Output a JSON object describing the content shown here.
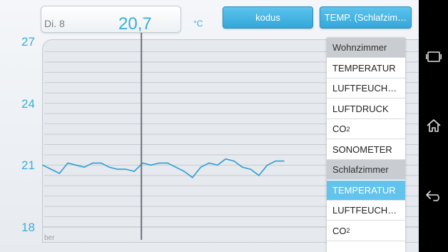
{
  "tooltip": {
    "date": "Di. 8",
    "value": "20,7",
    "unit": "°C"
  },
  "buttons": {
    "kodus": "kodus",
    "temp": "TEMP. (Schlafzim…"
  },
  "dropdown": {
    "items": [
      {
        "label": "Wohnzimmer",
        "type": "header"
      },
      {
        "label": "TEMPERATUR",
        "type": "option"
      },
      {
        "label": "LUFTFEUCH…",
        "type": "option"
      },
      {
        "label": "LUFTDRUCK",
        "type": "option"
      },
      {
        "label": "CO2",
        "type": "option"
      },
      {
        "label": "SONOMETER",
        "type": "option"
      },
      {
        "label": "Schlafzimmer",
        "type": "header"
      },
      {
        "label": "TEMPERATUR",
        "type": "selected"
      },
      {
        "label": "LUFTFEUCH…",
        "type": "option"
      },
      {
        "label": "CO2",
        "type": "option"
      }
    ]
  },
  "chart_data": {
    "type": "line",
    "title": "",
    "xlabel": "",
    "ylabel": "",
    "y_ticks": [
      "27",
      "24",
      "21",
      "18"
    ],
    "x_tick_partial": "ber",
    "ylim": [
      18,
      27
    ],
    "grid": true,
    "series": [
      {
        "color": "#2f9ed0",
        "values": [
          21.0,
          20.8,
          20.6,
          21.1,
          21.0,
          20.9,
          21.1,
          21.1,
          20.9,
          20.8,
          20.8,
          20.7,
          21.1,
          21.0,
          21.1,
          21.1,
          20.9,
          20.7,
          20.4,
          20.9,
          21.1,
          21.0,
          21.3,
          21.2,
          20.9,
          20.8,
          20.5,
          21.0,
          21.2,
          21.2
        ]
      }
    ],
    "cursor_index": 11,
    "colors": {
      "accent": "#3aaed6",
      "header_bg": "#c9ccd0",
      "selected_bg": "#62c3ec"
    }
  }
}
